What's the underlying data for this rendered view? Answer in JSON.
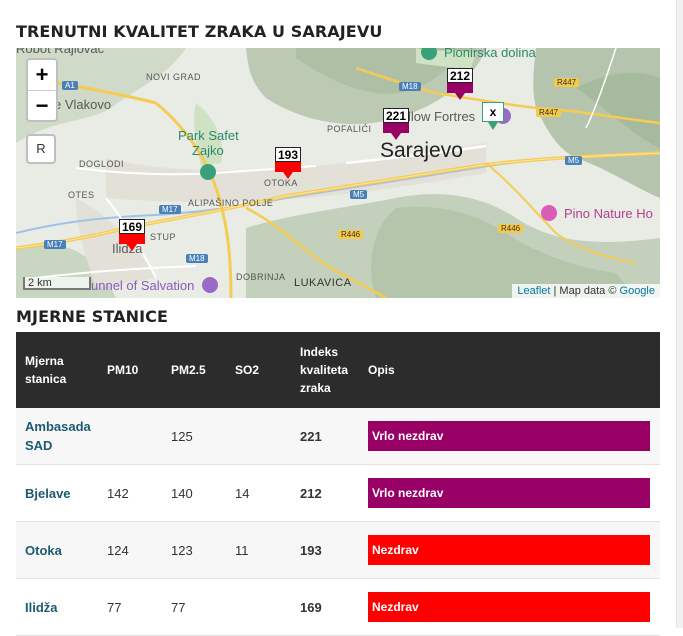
{
  "page": {
    "title": "TRENUTNI KVALITET ZRAKA U SARAJEVU",
    "stations_title": "MJERNE STANICE"
  },
  "colors": {
    "very_unhealthy": "#990066",
    "unhealthy": "#ff0000",
    "header_bg": "#2c2c2c",
    "station_link": "#1d5a72"
  },
  "map": {
    "zoom_in": "+",
    "zoom_out": "−",
    "reset": "R",
    "scale": "2 km",
    "attribution": {
      "leaflet": "Leaflet",
      "separator": " | Map data © ",
      "google": "Google"
    },
    "labels": {
      "sarajevo": "Sarajevo",
      "novi_grad": "NOVI GRAD",
      "doglodi": "DOGLODI",
      "otes": "OTES",
      "otoka": "OTOKA",
      "alipasino": "ALIPAŠINO POLJE",
      "pofalici": "POFALIĆI",
      "dobrinja": "DOBRINJA",
      "lukavica": "LUKAVICA",
      "stup": "STUP",
      "ilidza": "Ilidža",
      "vlakovo": "e Vlakovo",
      "park": "Park Safet",
      "zajko": "Zajko",
      "pionirska": "Pionirska dolina",
      "fortress": "llow Fortres",
      "pino": "Pino Nature Ho",
      "tunnel": "unnel of Salvation",
      "robot": "Robot Rajlovac"
    },
    "roads": {
      "m18a": "M18",
      "m18b": "M18",
      "m17a": "M17",
      "m17b": "M17",
      "m5a": "M5",
      "m5b": "M5",
      "a1": "A1",
      "r447a": "R447",
      "r447b": "R447",
      "r446a": "R446",
      "r446b": "R446"
    },
    "markers": {
      "ambasada": "221",
      "bjelave": "212",
      "otoka": "193",
      "ilidza": "169",
      "x": "x"
    }
  },
  "table": {
    "headers": {
      "station": "Mjerna stanica",
      "pm10": "PM10",
      "pm25": "PM2.5",
      "so2": "SO2",
      "aqi": "Indeks kvaliteta zraka",
      "desc": "Opis"
    },
    "rows": [
      {
        "station": "Ambasada SAD",
        "pm10": "",
        "pm25": "125",
        "so2": "",
        "aqi": "221",
        "desc": "Vrlo nezdrav"
      },
      {
        "station": "Bjelave",
        "pm10": "142",
        "pm25": "140",
        "so2": "14",
        "aqi": "212",
        "desc": "Vrlo nezdrav"
      },
      {
        "station": "Otoka",
        "pm10": "124",
        "pm25": "123",
        "so2": "11",
        "aqi": "193",
        "desc": "Nezdrav"
      },
      {
        "station": "Ilidža",
        "pm10": "77",
        "pm25": "77",
        "so2": "",
        "aqi": "169",
        "desc": "Nezdrav"
      }
    ]
  }
}
